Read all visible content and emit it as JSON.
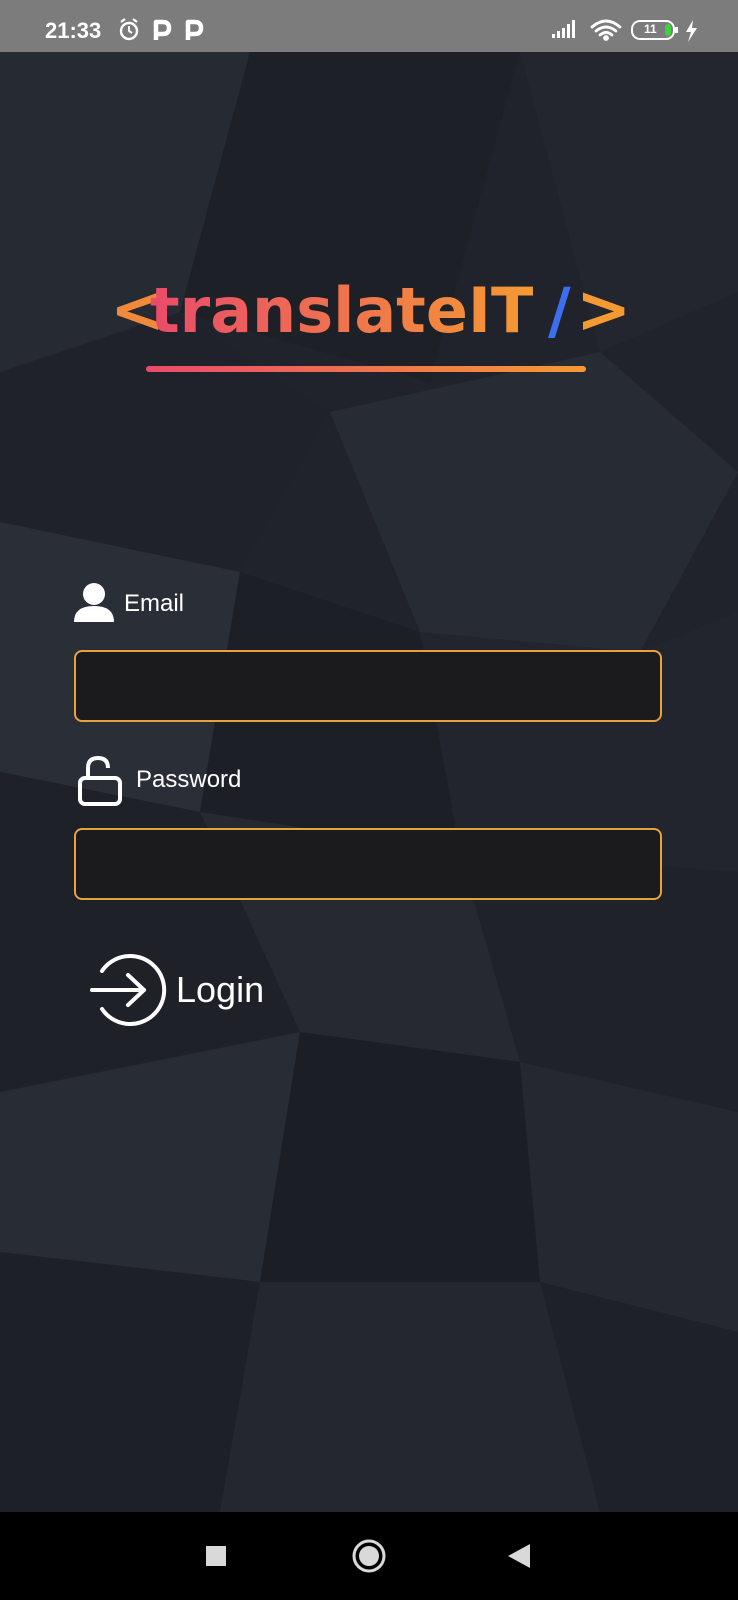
{
  "status_bar": {
    "time": "21:33",
    "left_icons": [
      "alarm-icon",
      "parking-icon",
      "parking-icon"
    ],
    "right_icons": [
      "signal-icon",
      "wifi-icon",
      "battery-icon",
      "charging-icon"
    ],
    "battery_level": "11"
  },
  "logo": {
    "open_bracket": "<",
    "text": "translateIT",
    "slash": "/",
    "close_bracket": ">"
  },
  "form": {
    "email": {
      "label": "Email",
      "icon": "person-icon",
      "value": "",
      "placeholder": ""
    },
    "password": {
      "label": "Password",
      "icon": "unlock-icon",
      "value": "",
      "placeholder": ""
    },
    "login": {
      "label": "Login",
      "icon": "login-arrow-icon"
    }
  },
  "nav_bar": {
    "buttons": [
      "recents-square-icon",
      "home-circle-icon",
      "back-triangle-icon"
    ]
  },
  "colors": {
    "accent": "#e8a23b",
    "input_bg": "#1b1b1d",
    "background": "#20232b",
    "logo_gradient_start": "#e94b6a",
    "logo_gradient_end": "#f59a33",
    "slash_blue": "#3c6ff0"
  }
}
